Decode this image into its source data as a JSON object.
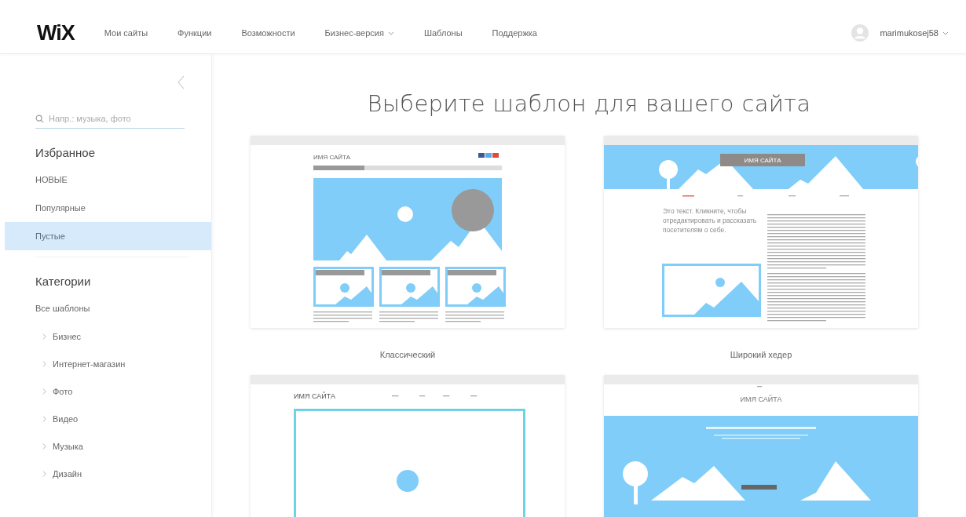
{
  "header": {
    "logo": "WiX",
    "nav": [
      {
        "label": "Мои сайты",
        "dropdown": false
      },
      {
        "label": "Функции",
        "dropdown": false
      },
      {
        "label": "Возможности",
        "dropdown": false
      },
      {
        "label": "Бизнес-версия",
        "dropdown": true
      },
      {
        "label": "Шаблоны",
        "dropdown": false
      },
      {
        "label": "Поддержка",
        "dropdown": false
      }
    ],
    "user": {
      "name": "marimukosej58"
    }
  },
  "sidebar": {
    "search": {
      "placeholder": "Напр.: музыка, фото"
    },
    "sections": [
      {
        "title": "Избранное",
        "items": [
          {
            "label": "НОВЫЕ",
            "selected": false
          },
          {
            "label": "Популярные",
            "selected": false
          },
          {
            "label": "Пустые",
            "selected": true
          }
        ]
      },
      {
        "title": "Категории",
        "items": [
          {
            "label": "Все шаблоны",
            "selected": false,
            "children": [
              {
                "label": "Бизнес",
                "selected": false,
                "expanded": false
              },
              {
                "label": "Интернет-магазин",
                "selected": false,
                "expanded": false
              },
              {
                "label": "Фото",
                "selected": false,
                "expanded": false
              },
              {
                "label": "Видео",
                "selected": false,
                "expanded": false
              },
              {
                "label": "Музыка",
                "selected": false,
                "expanded": false
              },
              {
                "label": "Дизайн",
                "selected": false,
                "expanded": false
              }
            ]
          }
        ]
      }
    ]
  },
  "main": {
    "title": "Выберите шаблон для вашего сайта",
    "templates": [
      {
        "kind": "classic",
        "site_name": "ИМЯ САЙТА",
        "caption": "Классический"
      },
      {
        "kind": "wide-header",
        "site_name": "ИМЯ САЙТА",
        "heading": "Это текст. Кликните, чтобы отредактировать и рассказать посетителям о себе.",
        "caption": "Широкий хедер"
      },
      {
        "kind": "frame",
        "site_name": "ИМЯ САЙТА"
      },
      {
        "kind": "banner",
        "site_name": "ИМЯ САЙТА"
      }
    ]
  }
}
